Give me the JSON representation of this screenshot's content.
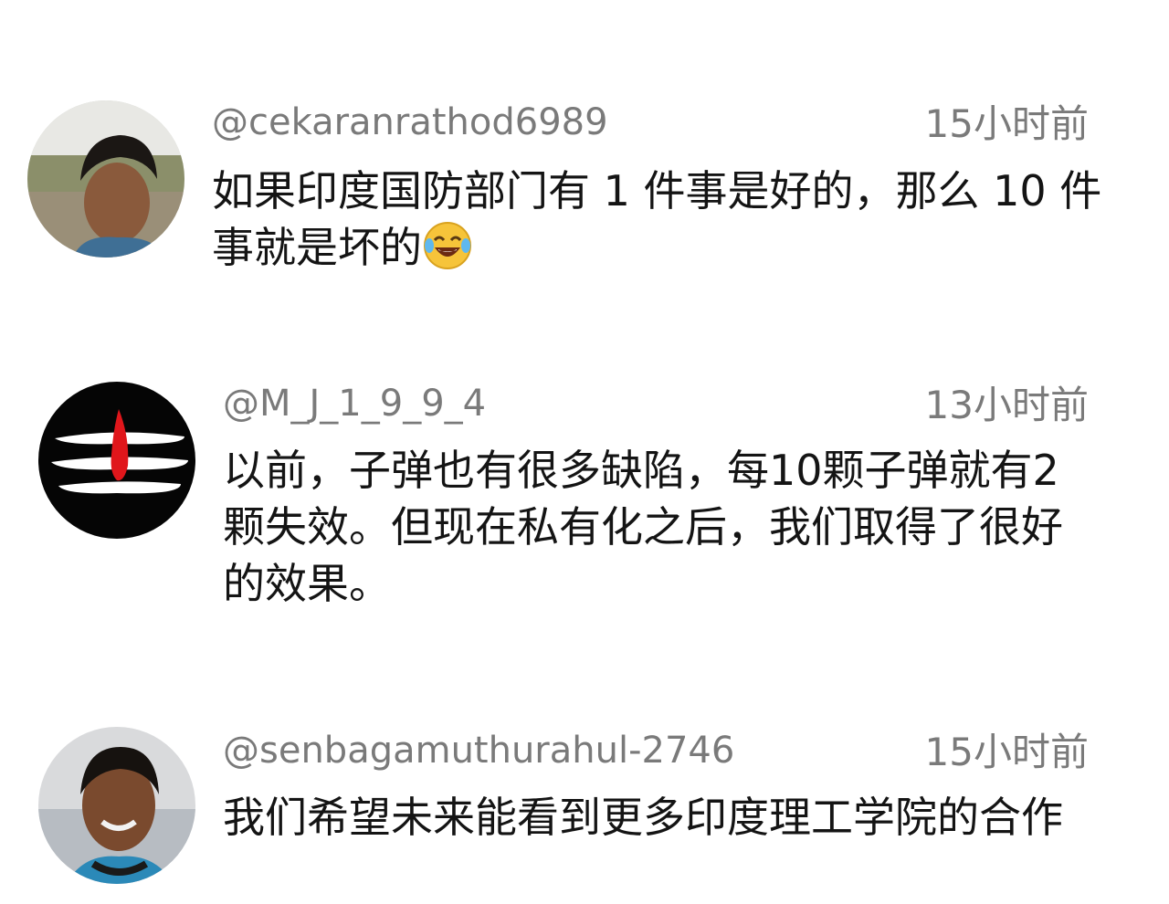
{
  "comments": [
    {
      "handle": "@cekaranrathod6989",
      "time": "15小时前",
      "text": "如果印度国防部门有 1 件事是好的，那么 10 件事就是坏的",
      "emoji": "face-with-tears-of-joy"
    },
    {
      "handle": "@M_J_1_9_9_4",
      "time": "13小时前",
      "text": "以前，子弹也有很多缺陷，每10颗子弹就有2颗失效。但现在私有化之后，我们取得了很好的效果。"
    },
    {
      "handle": "@senbagamuthurahul-2746",
      "time": "15小时前",
      "text": "我们希望未来能看到更多印度理工学院的合作"
    }
  ]
}
